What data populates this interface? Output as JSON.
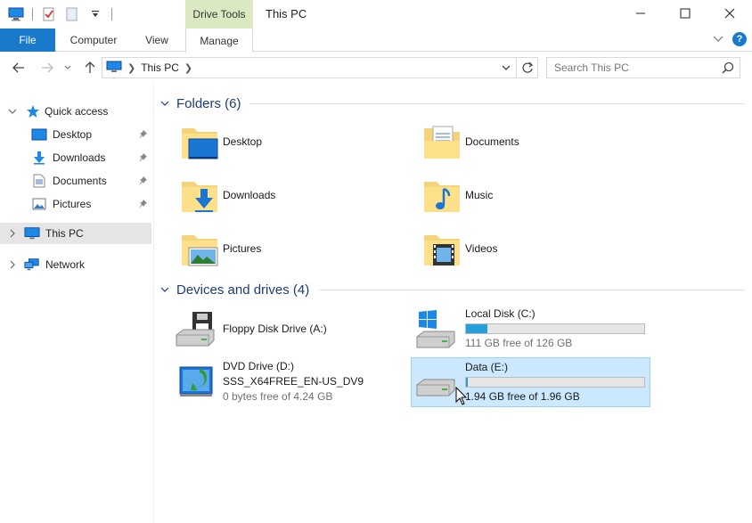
{
  "window": {
    "title": "This PC",
    "contextual_tab": "Drive Tools"
  },
  "ribbon": {
    "tabs": [
      "File",
      "Computer",
      "View",
      "Manage"
    ],
    "help": "?"
  },
  "address": {
    "crumbs": [
      "This PC"
    ],
    "search_placeholder": "Search This PC"
  },
  "sidebar": {
    "quick_access": "Quick access",
    "pinned": [
      "Desktop",
      "Downloads",
      "Documents",
      "Pictures"
    ],
    "this_pc": "This PC",
    "network": "Network"
  },
  "folders": {
    "header": "Folders (6)",
    "items": [
      "Desktop",
      "Documents",
      "Downloads",
      "Music",
      "Pictures",
      "Videos"
    ]
  },
  "devices": {
    "header": "Devices and drives (4)",
    "floppy": {
      "name": "Floppy Disk Drive (A:)"
    },
    "local_disk": {
      "name": "Local Disk (C:)",
      "free_text": "111 GB free of 126 GB",
      "used_fraction": 0.12
    },
    "dvd": {
      "name": "DVD Drive (D:)",
      "label": "SSS_X64FREE_EN-US_DV9",
      "free_text": "0 bytes free of 4.24 GB"
    },
    "data": {
      "name": "Data (E:)",
      "free_text": "1.94 GB free of 1.96 GB",
      "used_fraction": 0.01
    }
  },
  "colors": {
    "accent": "#1979ca",
    "context_tab_bg": "#dbe9c2",
    "group_header": "#1e3c78",
    "selection_bg": "#cce8ff",
    "bar_fill": "#26a0da"
  }
}
